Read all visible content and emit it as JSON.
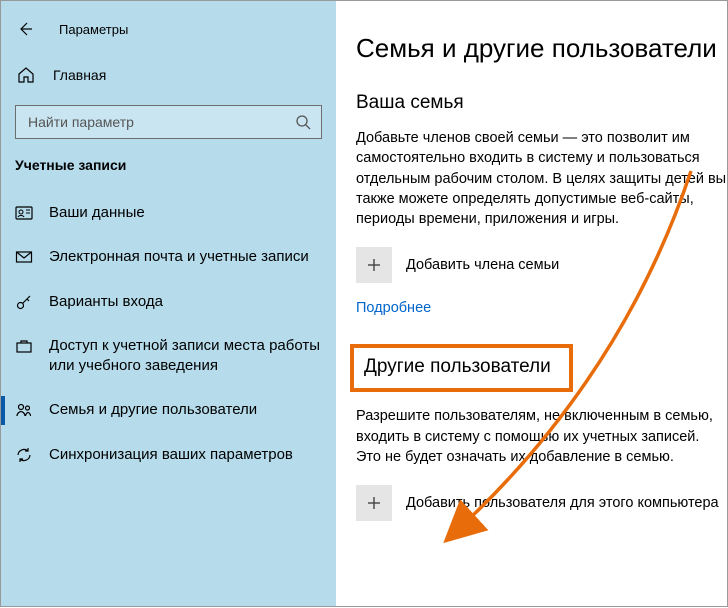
{
  "window": {
    "title": "Параметры"
  },
  "sidebar": {
    "home_label": "Главная",
    "search_placeholder": "Найти параметр",
    "section_label": "Учетные записи",
    "items": [
      {
        "label": "Ваши данные"
      },
      {
        "label": "Электронная почта и учетные записи"
      },
      {
        "label": "Варианты входа"
      },
      {
        "label": "Доступ к учетной записи места работы или учебного заведения"
      },
      {
        "label": "Семья и другие пользователи"
      },
      {
        "label": "Синхронизация ваших параметров"
      }
    ]
  },
  "content": {
    "page_title": "Семья и другие пользователи",
    "family": {
      "heading": "Ваша семья",
      "description": "Добавьте членов своей семьи — это позволит им самостоятельно входить в систему и пользоваться отдельным рабочим столом. В целях защиты детей вы также можете определять допустимые веб-сайты, периоды времени, приложения и игры.",
      "add_label": "Добавить члена семьи",
      "more_link": "Подробнее"
    },
    "others": {
      "heading": "Другие пользователи",
      "description": "Разрешите пользователям, не включенным в семью, входить в систему с помощью их учетных записей. Это не будет означать их добавление в семью.",
      "add_label": "Добавить пользователя для этого компьютера"
    }
  }
}
